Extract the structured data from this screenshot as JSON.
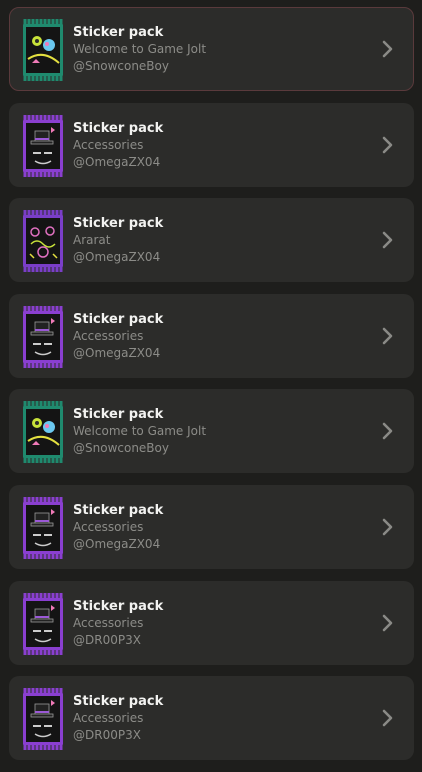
{
  "items": [
    {
      "title": "Sticker pack",
      "pack": "Welcome to Game Jolt",
      "author": "@SnowconeBoy",
      "art": "welcome-pack-art",
      "selected": true
    },
    {
      "title": "Sticker pack",
      "pack": "Accessories",
      "author": "@OmegaZX04",
      "art": "accessories-pack-art",
      "selected": false
    },
    {
      "title": "Sticker pack",
      "pack": "Ararat",
      "author": "@OmegaZX04",
      "art": "ararat-pack-art",
      "selected": false
    },
    {
      "title": "Sticker pack",
      "pack": "Accessories",
      "author": "@OmegaZX04",
      "art": "accessories-pack-art",
      "selected": false
    },
    {
      "title": "Sticker pack",
      "pack": "Welcome to Game Jolt",
      "author": "@SnowconeBoy",
      "art": "welcome-pack-art",
      "selected": false
    },
    {
      "title": "Sticker pack",
      "pack": "Accessories",
      "author": "@OmegaZX04",
      "art": "accessories-pack-art",
      "selected": false
    },
    {
      "title": "Sticker pack",
      "pack": "Accessories",
      "author": "@DR00P3X",
      "art": "accessories-pack-art",
      "selected": false
    },
    {
      "title": "Sticker pack",
      "pack": "Accessories",
      "author": "@DR00P3X",
      "art": "accessories-pack-art",
      "selected": false
    }
  ],
  "colors": {
    "background": "#1e1e1c",
    "card": "#2c2c2a",
    "selected_border": "#5a3a3c",
    "title": "#f2f2f0",
    "subtitle": "#8c8c88",
    "chevron": "#8a8a86",
    "welcome_wrapper": "#1f8a6e",
    "accessories_wrapper": "#8a3fd0",
    "ararat_wrapper": "#7a3ec8"
  },
  "icons": {
    "chevron": "chevron-right-icon"
  }
}
